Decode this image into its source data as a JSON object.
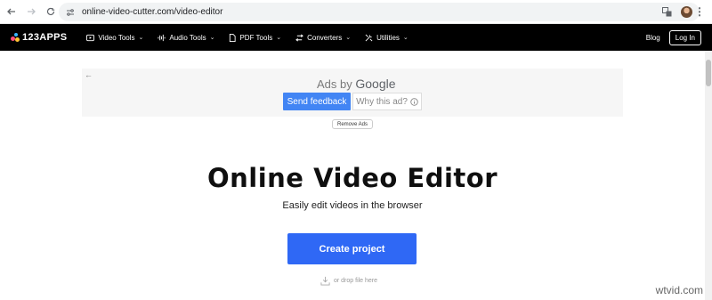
{
  "browser": {
    "url": "online-video-cutter.com/video-editor",
    "back_icon": "arrow-left-icon",
    "forward_icon": "arrow-right-icon",
    "reload_icon": "reload-icon",
    "translate_icon": "translate-icon",
    "star_icon": "star-icon",
    "more_icon": "more-vertical-icon"
  },
  "site_nav": {
    "logo_text": "123APPS",
    "menu": [
      {
        "label": "Video Tools",
        "icon": "play-icon"
      },
      {
        "label": "Audio Tools",
        "icon": "audio-wave-icon"
      },
      {
        "label": "PDF Tools",
        "icon": "document-icon"
      },
      {
        "label": "Converters",
        "icon": "convert-icon"
      },
      {
        "label": "Utilities",
        "icon": "tools-icon"
      }
    ],
    "blog_label": "Blog",
    "login_label": "Log In"
  },
  "ad": {
    "ads_by_prefix": "Ads by ",
    "ads_by_brand": "Google",
    "send_feedback": "Send feedback",
    "why_this_ad": "Why this ad?",
    "remove_ads": "Remove Ads"
  },
  "main": {
    "title": "Online Video Editor",
    "subtitle": "Easily edit videos in the browser",
    "create_button": "Create project",
    "drop_hint": "or drop file here"
  },
  "watermark": "wtvid.com",
  "colors": {
    "nav_bg": "#000000",
    "primary_button": "#2f68f5",
    "ad_button": "#4285f4"
  }
}
